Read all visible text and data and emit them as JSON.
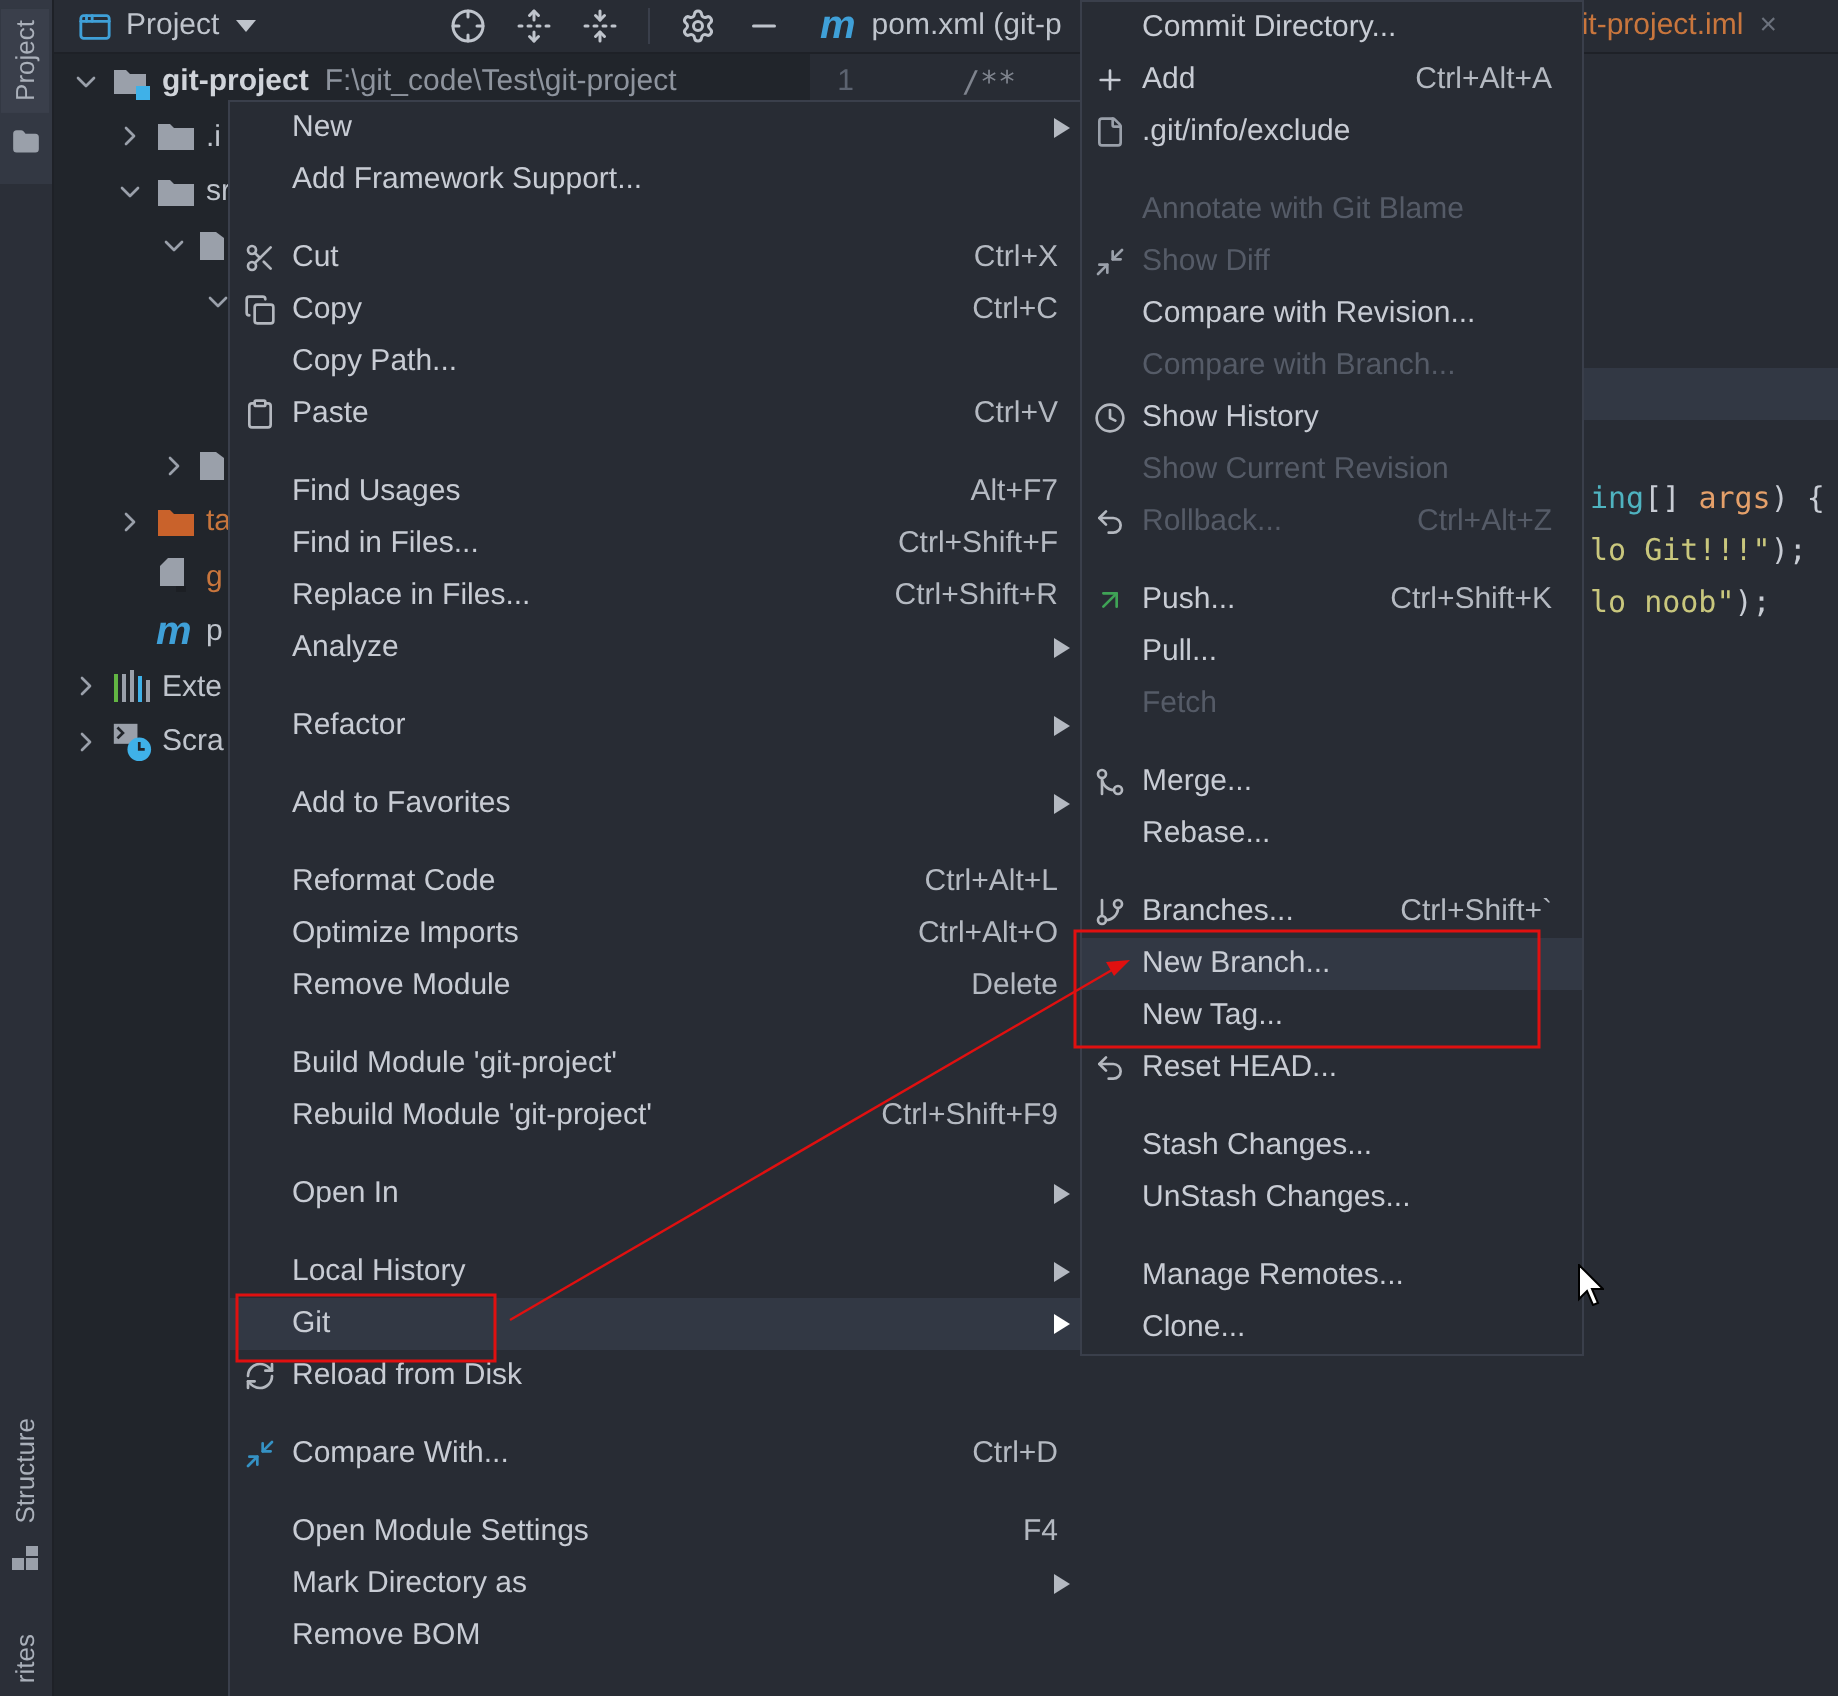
{
  "tool_strip": {
    "top": [
      {
        "label": "Project",
        "selected": true
      }
    ],
    "bottom": [
      {
        "label": "Structure",
        "selected": false
      },
      {
        "label": "rites",
        "selected": false
      }
    ]
  },
  "project_panel": {
    "title": "Project",
    "tree": [
      {
        "kind": "module",
        "label": "git-project",
        "path": "F:\\git_code\\Test\\git-project",
        "expanded": true,
        "children": [
          {
            "kind": "folder",
            "label": ".i",
            "expanded": false
          },
          {
            "kind": "folder",
            "label": "sr",
            "expanded": true,
            "children": [
              {
                "kind": "package",
                "expanded": true,
                "children": [
                  {
                    "expanded": true
                  }
                ]
              },
              {
                "kind": "package",
                "expanded": false
              }
            ]
          },
          {
            "kind": "excluded",
            "label": "ta",
            "expanded": false
          },
          {
            "kind": "file",
            "label": "g"
          },
          {
            "kind": "maven",
            "badge": "m",
            "label": "p"
          }
        ]
      },
      {
        "kind": "library",
        "label": "Exte",
        "expanded": false
      },
      {
        "kind": "scratch",
        "label": "Scra",
        "expanded": false
      }
    ]
  },
  "editor": {
    "tabs": [
      {
        "badge": "m",
        "label": "pom.xml (git-p"
      },
      {
        "label": "it-project.iml",
        "close": "×"
      }
    ],
    "lines": [
      {
        "number": "1",
        "tokens": [
          {
            "kind": "comment",
            "text": "/**"
          }
        ],
        "current": false
      },
      {
        "current": false
      },
      {
        "current": false
      },
      {
        "current": false
      },
      {
        "current": false
      },
      {
        "current": false
      },
      {
        "current": true
      },
      {
        "current": false
      },
      {
        "tokens": [
          {
            "kind": "type",
            "text": "ing"
          },
          {
            "kind": "plain",
            "text": "[] "
          },
          {
            "kind": "param",
            "text": "args"
          },
          {
            "kind": "plain",
            "text": ") {"
          }
        ],
        "current": false
      },
      {
        "tokens": [
          {
            "kind": "string",
            "text": "lo Git!!!\""
          },
          {
            "kind": "plain",
            "text": ");"
          }
        ],
        "current": false
      },
      {
        "tokens": [
          {
            "kind": "string",
            "text": "lo noob\""
          },
          {
            "kind": "plain",
            "text": ");"
          }
        ],
        "current": false
      }
    ]
  },
  "context_menu": {
    "sections": [
      [
        {
          "label": "New",
          "submenu": true,
          "selected": false
        },
        {
          "label": "Add Framework Support...",
          "selected": false
        }
      ],
      [
        {
          "label": "Cut",
          "shortcut": "Ctrl+X",
          "selected": false
        },
        {
          "label": "Copy",
          "shortcut": "Ctrl+C",
          "selected": false
        },
        {
          "label": "Copy Path...",
          "selected": false
        },
        {
          "label": "Paste",
          "shortcut": "Ctrl+V",
          "selected": false
        }
      ],
      [
        {
          "label": "Find Usages",
          "shortcut": "Alt+F7",
          "selected": false
        },
        {
          "label": "Find in Files...",
          "shortcut": "Ctrl+Shift+F",
          "selected": false
        },
        {
          "label": "Replace in Files...",
          "shortcut": "Ctrl+Shift+R",
          "selected": false
        },
        {
          "label": "Analyze",
          "submenu": true,
          "selected": false
        }
      ],
      [
        {
          "label": "Refactor",
          "submenu": true,
          "selected": false
        }
      ],
      [
        {
          "label": "Add to Favorites",
          "submenu": true,
          "selected": false
        }
      ],
      [
        {
          "label": "Reformat Code",
          "shortcut": "Ctrl+Alt+L",
          "selected": false
        },
        {
          "label": "Optimize Imports",
          "shortcut": "Ctrl+Alt+O",
          "selected": false
        },
        {
          "label": "Remove Module",
          "shortcut": "Delete",
          "selected": false
        }
      ],
      [
        {
          "label": "Build Module 'git-project'",
          "selected": false
        },
        {
          "label": "Rebuild Module 'git-project'",
          "shortcut": "Ctrl+Shift+F9",
          "selected": false
        }
      ],
      [
        {
          "label": "Open In",
          "submenu": true,
          "selected": false
        }
      ],
      [
        {
          "label": "Local History",
          "submenu": true,
          "selected": false
        },
        {
          "label": "Git",
          "submenu": true,
          "selected": true
        },
        {
          "label": "Reload from Disk",
          "selected": false
        }
      ],
      [
        {
          "label": "Compare With...",
          "shortcut": "Ctrl+D",
          "selected": false
        }
      ],
      [
        {
          "label": "Open Module Settings",
          "shortcut": "F4",
          "selected": false
        },
        {
          "label": "Mark Directory as",
          "submenu": true,
          "selected": false
        },
        {
          "label": "Remove BOM",
          "selected": false
        }
      ]
    ]
  },
  "git_submenu": {
    "sections": [
      [
        {
          "label": "Commit Directory...",
          "disabled": false,
          "selected": false
        },
        {
          "label": "Add",
          "shortcut": "Ctrl+Alt+A",
          "disabled": false,
          "selected": false
        },
        {
          "label": ".git/info/exclude",
          "disabled": false,
          "selected": false
        }
      ],
      [
        {
          "label": "Annotate with Git Blame",
          "disabled": true,
          "selected": false
        },
        {
          "label": "Show Diff",
          "disabled": true,
          "selected": false
        },
        {
          "label": "Compare with Revision...",
          "disabled": false,
          "selected": false
        },
        {
          "label": "Compare with Branch...",
          "disabled": true,
          "selected": false
        },
        {
          "label": "Show History",
          "disabled": false,
          "selected": false
        },
        {
          "label": "Show Current Revision",
          "disabled": true,
          "selected": false
        },
        {
          "label": "Rollback...",
          "shortcut": "Ctrl+Alt+Z",
          "disabled": true,
          "selected": false
        }
      ],
      [
        {
          "label": "Push...",
          "shortcut": "Ctrl+Shift+K",
          "disabled": false,
          "selected": false
        },
        {
          "label": "Pull...",
          "disabled": false,
          "selected": false
        },
        {
          "label": "Fetch",
          "disabled": true,
          "selected": false
        }
      ],
      [
        {
          "label": "Merge...",
          "disabled": false,
          "selected": false
        },
        {
          "label": "Rebase...",
          "disabled": false,
          "selected": false
        }
      ],
      [
        {
          "label": "Branches...",
          "shortcut": "Ctrl+Shift+`",
          "disabled": false,
          "selected": false
        },
        {
          "label": "New Branch...",
          "disabled": false,
          "selected": true
        },
        {
          "label": "New Tag...",
          "disabled": false,
          "selected": false
        },
        {
          "label": "Reset HEAD...",
          "disabled": false,
          "selected": false
        }
      ],
      [
        {
          "label": "Stash Changes...",
          "disabled": false,
          "selected": false
        },
        {
          "label": "UnStash Changes...",
          "disabled": false,
          "selected": false
        }
      ],
      [
        {
          "label": "Manage Remotes...",
          "disabled": false,
          "selected": false
        },
        {
          "label": "Clone...",
          "disabled": false,
          "selected": false
        }
      ]
    ]
  },
  "annotations": [
    {
      "kind": "frame"
    },
    {
      "kind": "frame"
    },
    {
      "kind": "arrow"
    }
  ]
}
